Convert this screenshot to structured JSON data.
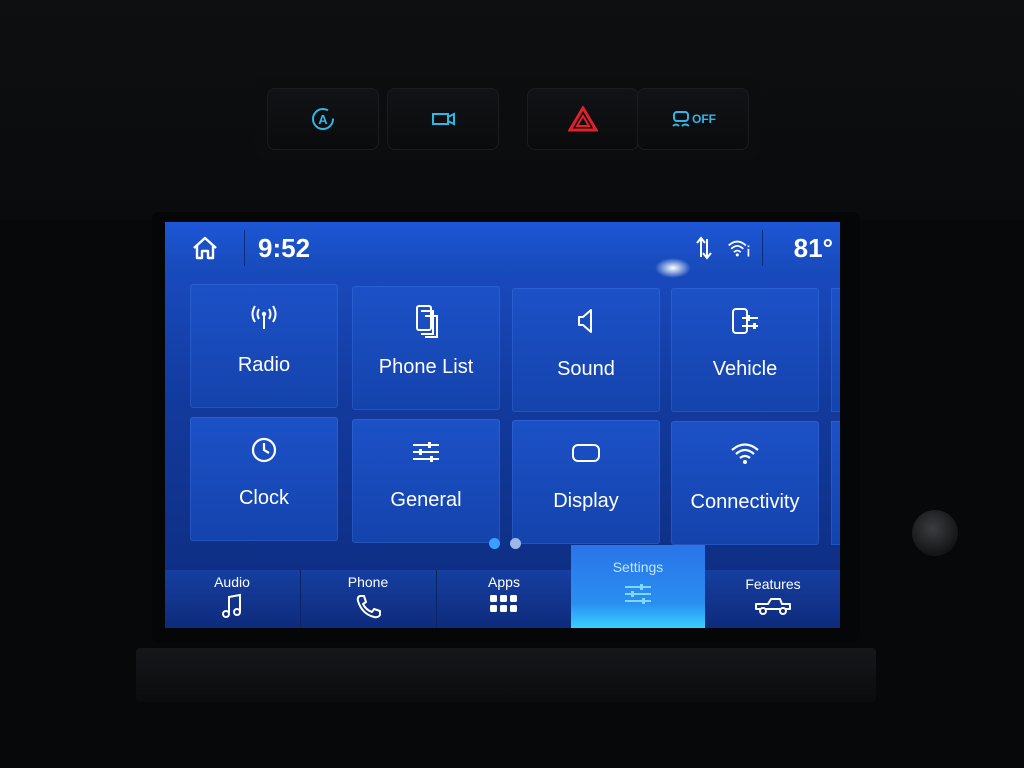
{
  "hardware_buttons": {
    "auto_stop_start": {
      "icon": "auto-start-stop-icon",
      "label": "A"
    },
    "camera": {
      "icon": "camera-icon"
    },
    "hazard": {
      "icon": "hazard-triangle-icon",
      "color": "#e0202a"
    },
    "traction_control": {
      "icon": "traction-control-off-icon",
      "label": "OFF"
    },
    "accent_color": "#2fb8e6"
  },
  "status_bar": {
    "time": "9:52",
    "temperature": "81°",
    "icons": [
      "home-icon",
      "data-transfer-icon",
      "wifi-info-icon"
    ]
  },
  "settings_grid": {
    "page_count": 2,
    "current_page": 1,
    "tiles": [
      {
        "label": "Radio",
        "icon": "radio-antenna-icon"
      },
      {
        "label": "Phone List",
        "icon": "phone-list-icon"
      },
      {
        "label": "Sound",
        "icon": "speaker-icon"
      },
      {
        "label": "Vehicle",
        "icon": "vehicle-settings-icon"
      },
      {
        "label": "Clock",
        "icon": "clock-icon"
      },
      {
        "label": "General",
        "icon": "sliders-icon"
      },
      {
        "label": "Display",
        "icon": "display-icon"
      },
      {
        "label": "Connectivity",
        "icon": "wifi-icon"
      }
    ]
  },
  "nav_bar": {
    "items": [
      {
        "label": "Audio",
        "icon": "music-note-icon"
      },
      {
        "label": "Phone",
        "icon": "phone-icon"
      },
      {
        "label": "Apps",
        "icon": "apps-grid-icon"
      },
      {
        "label": "Settings",
        "icon": "settings-sliders-icon",
        "active": true
      },
      {
        "label": "Features",
        "icon": "truck-icon"
      }
    ]
  },
  "colors": {
    "screen_blue": "#1b4fc9",
    "active_tab": "#2a8ef0",
    "page_dot_active": "#3aa0ff",
    "page_dot_inactive": "#9db8e8"
  }
}
